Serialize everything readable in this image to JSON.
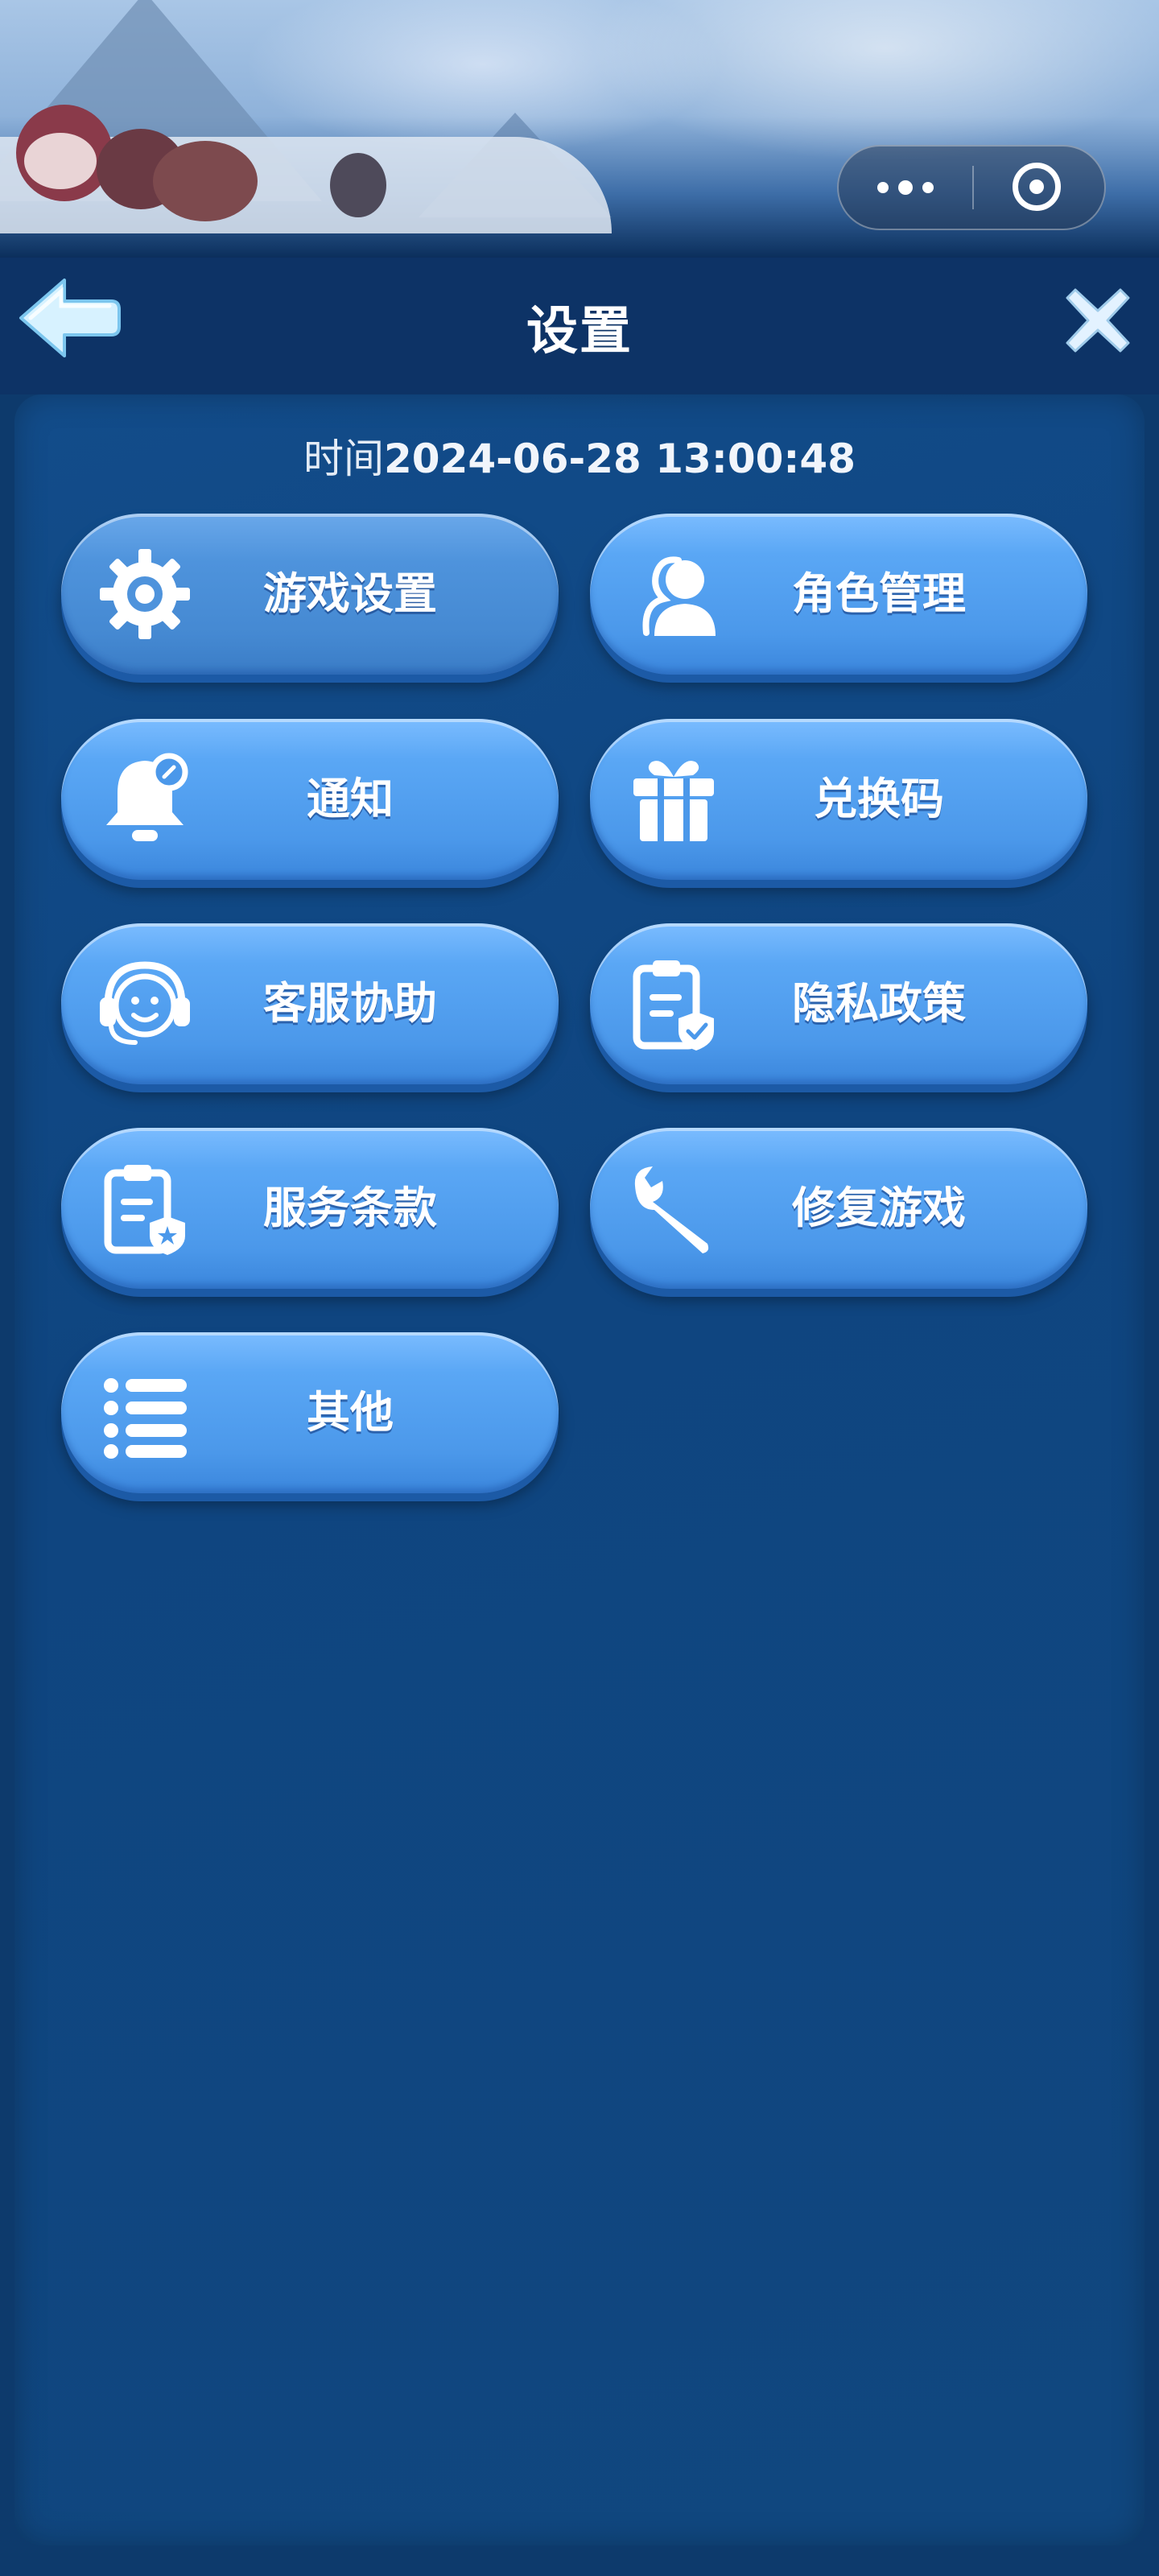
{
  "capsule": {
    "more_icon": "more-dots-icon",
    "target_icon": "target-icon"
  },
  "header": {
    "title": "设置",
    "back_icon": "back-arrow-icon",
    "close_icon": "close-icon"
  },
  "time": {
    "label": "时间",
    "value": "2024-06-28 13:00:48"
  },
  "menu": [
    {
      "label": "游戏设置",
      "icon": "gear-icon",
      "active": true
    },
    {
      "label": "角色管理",
      "icon": "users-icon"
    },
    {
      "label": "通知",
      "icon": "bell-icon"
    },
    {
      "label": "兑换码",
      "icon": "gift-icon"
    },
    {
      "label": "客服协助",
      "icon": "headset-icon"
    },
    {
      "label": "隐私政策",
      "icon": "privacy-document-icon"
    },
    {
      "label": "服务条款",
      "icon": "terms-document-icon"
    },
    {
      "label": "修复游戏",
      "icon": "wrench-icon"
    },
    {
      "label": "其他",
      "icon": "list-icon"
    }
  ]
}
